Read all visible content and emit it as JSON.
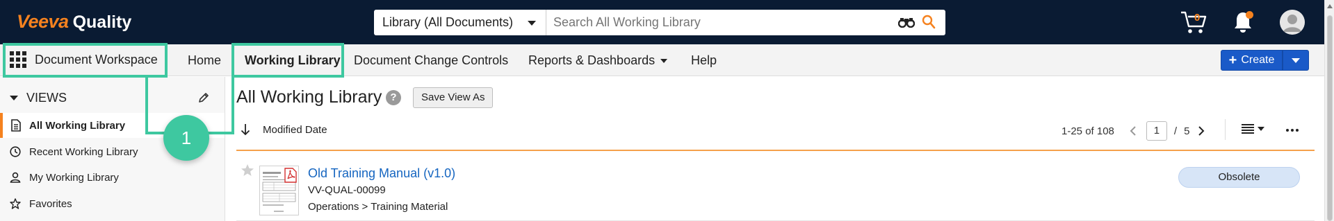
{
  "app": {
    "brand": "Veeva",
    "product": "Quality"
  },
  "search": {
    "scope": "Library (All Documents)",
    "placeholder": "Search All Working Library"
  },
  "header": {
    "cart_count": "0",
    "icons": [
      "binoculars-icon",
      "search-icon",
      "cart-icon",
      "bell-icon",
      "avatar-icon"
    ]
  },
  "nav": {
    "workspace_label": "Document Workspace",
    "items": [
      {
        "label": "Home"
      },
      {
        "label": "Working Library"
      },
      {
        "label": "Document Change Controls"
      },
      {
        "label": "Reports & Dashboards"
      },
      {
        "label": "Help"
      }
    ],
    "create_label": "Create"
  },
  "sidebar": {
    "views_label": "VIEWS",
    "items": [
      {
        "label": "All Working Library",
        "icon": "document-icon"
      },
      {
        "label": "Recent Working Library",
        "icon": "clock-icon"
      },
      {
        "label": "My Working Library",
        "icon": "person-icon"
      },
      {
        "label": "Favorites",
        "icon": "star-icon"
      }
    ]
  },
  "main": {
    "title": "All Working Library",
    "help_glyph": "?",
    "save_view_label": "Save View As",
    "sort_label": "Modified Date",
    "pager": {
      "range": "1-25 of 108",
      "page": "1",
      "separator": "/",
      "total_pages": "5"
    }
  },
  "documents": [
    {
      "title": "Old Training Manual (v1.0)",
      "number": "VV-QUAL-00099",
      "path": "Operations > Training Material",
      "status": "Obsolete"
    }
  ],
  "annotation": {
    "callout_number": "1"
  },
  "colors": {
    "header_bg": "#0a1b33",
    "accent_orange": "#f5821f",
    "create_blue": "#1a5ac8",
    "link_blue": "#1565c0",
    "highlight_green": "#3ec8a0",
    "status_badge_bg": "#d7e5f7"
  }
}
